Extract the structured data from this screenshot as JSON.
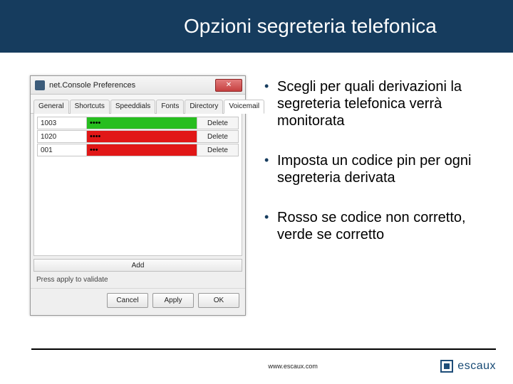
{
  "slide": {
    "title": "Opzioni segreteria telefonica",
    "bullets": [
      "Scegli per quali derivazioni la segreteria telefonica verrà monitorata",
      "Imposta un codice pin per ogni segreteria derivata",
      "Rosso se codice non corretto, verde se corretto"
    ],
    "footer_url": "www.escaux.com",
    "brand": "escaux"
  },
  "dialog": {
    "title": "net.Console Preferences",
    "close_glyph": "✕",
    "tabs": [
      "General",
      "Shortcuts",
      "Speeddials",
      "Fonts",
      "Directory",
      "Voicemail"
    ],
    "active_tab": "Voicemail",
    "rows": [
      {
        "ext": "1003",
        "pin": "••••",
        "status": "green",
        "del": "Delete"
      },
      {
        "ext": "1020",
        "pin": "••••",
        "status": "red",
        "del": "Delete"
      },
      {
        "ext": "001",
        "pin": "•••",
        "status": "red",
        "del": "Delete"
      }
    ],
    "add_label": "Add",
    "validate_note": "Press apply to validate",
    "buttons": {
      "cancel": "Cancel",
      "apply": "Apply",
      "ok": "OK"
    }
  }
}
